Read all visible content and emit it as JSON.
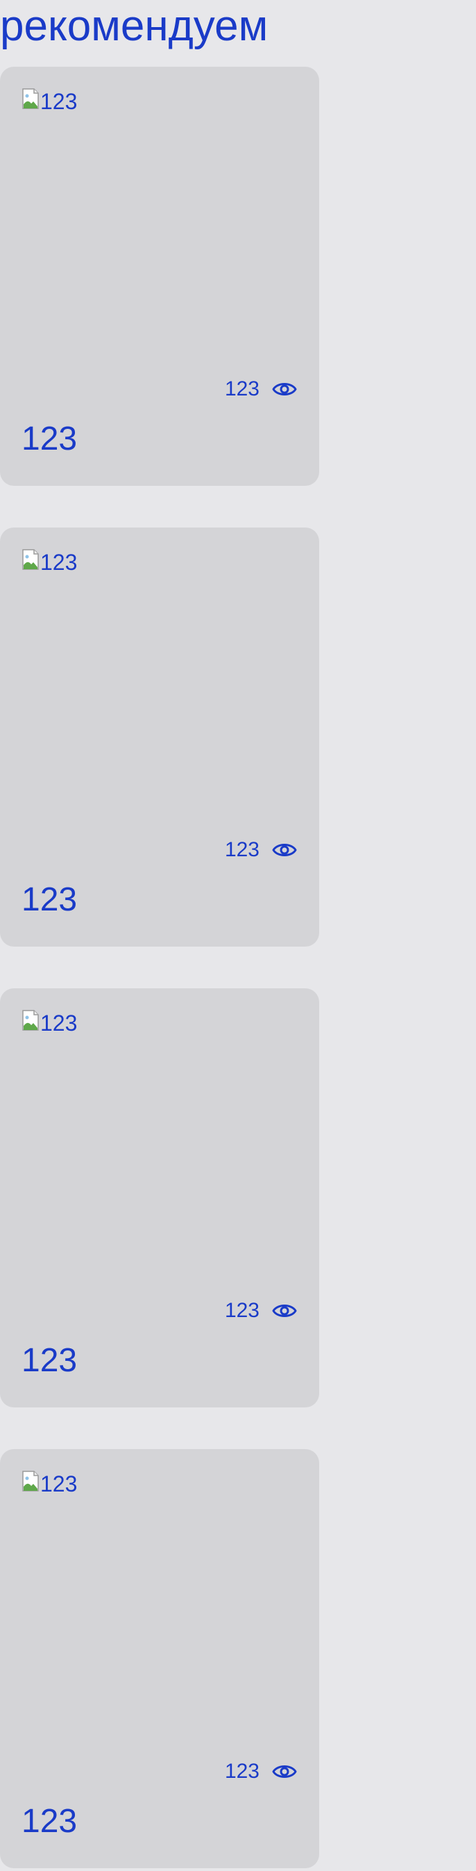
{
  "section": {
    "title": "рекомендуем"
  },
  "cards": [
    {
      "image_alt": "123",
      "views": "123",
      "title": "123"
    },
    {
      "image_alt": "123",
      "views": "123",
      "title": "123"
    },
    {
      "image_alt": "123",
      "views": "123",
      "title": "123"
    },
    {
      "image_alt": "123",
      "views": "123",
      "title": "123"
    }
  ],
  "icons": {
    "broken_image": "broken-image-icon",
    "views": "eye-icon"
  },
  "colors": {
    "page_background": "#e7e7ea",
    "card_background": "#d4d4d7",
    "text_accent": "#1a3bc8"
  }
}
